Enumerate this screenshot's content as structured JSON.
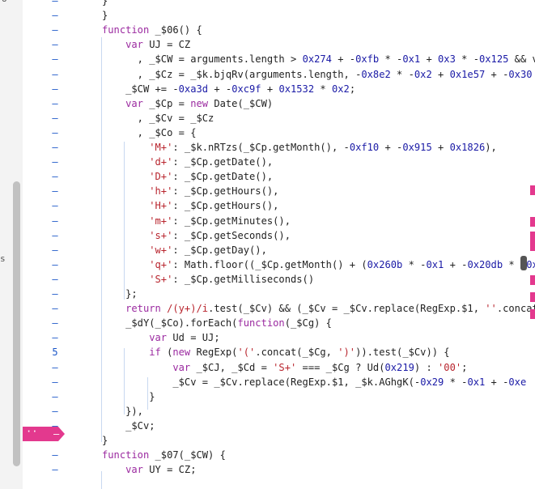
{
  "left_panel": {
    "glyph_top": "o",
    "glyph_mid": "s"
  },
  "gutter": {
    "numbered_line": "5",
    "dash": "–",
    "breakpoint_dots": "··",
    "breakpoint_dash": "–"
  },
  "code_lines": [
    "}",
    "}",
    "function _$06() {",
    "    var UJ = CZ",
    "      , _$CW = arguments.length > 0x274 + -0xfb * -0x1 + 0x3 * -0x125 && v",
    "      , _$Cz = _$k.bjqRv(arguments.length, -0x8e2 * -0x2 + 0x1e57 + -0x30",
    "    _$CW += -0xa3d + -0xc9f + 0x1532 * 0x2;",
    "    var _$Cp = new Date(_$CW)",
    "      , _$Cv = _$Cz",
    "      , _$Co = {",
    "        'M+': _$k.nRTzs(_$Cp.getMonth(), -0xf10 + -0x915 + 0x1826),",
    "        'd+': _$Cp.getDate(),",
    "        'D+': _$Cp.getDate(),",
    "        'h+': _$Cp.getHours(),",
    "        'H+': _$Cp.getHours(),",
    "        'm+': _$Cp.getMinutes(),",
    "        's+': _$Cp.getSeconds(),",
    "        'w+': _$Cp.getDay(),",
    "        'q+': Math.floor((_$Cp.getMonth() + (0x260b * -0x1 + -0x20db * -0x2",
    "        'S+': _$Cp.getMilliseconds()",
    "    };",
    "    return /(y+)/i.test(_$Cv) && (_$Cv = _$Cv.replace(RegExp.$1, ''.concat",
    "    _$dY(_$Co).forEach(function(_$Cg) {",
    "        var Ud = UJ;",
    "        if (new RegExp('('.concat(_$Cg, ')')).test(_$Cv)) {",
    "            var _$CJ, _$Cd = 'S+' === _$Cg ? Ud(0x219) : '00';",
    "            _$Cv = _$Cv.replace(RegExp.$1, _$k.AGhgK(-0x29 * -0x1 + -0xe",
    "        }",
    "    }),",
    "    _$Cv;",
    "}",
    "function _$07(_$CW) {",
    "    var UY = CZ;"
  ],
  "colors": {
    "keyword": "#9b2aa0",
    "number": "#1a1aa6",
    "string": "#b8242d",
    "breakpoint": "#e3398e",
    "line_number": "#1a56c8"
  }
}
